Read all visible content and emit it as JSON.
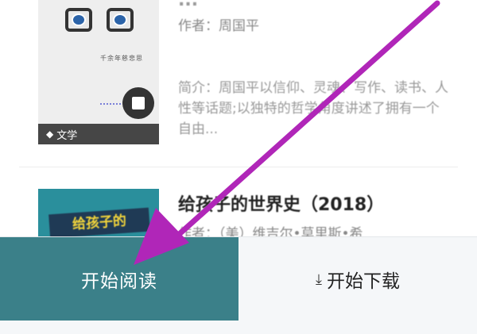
{
  "books": [
    {
      "title": "...",
      "author_label": "作者：",
      "author": "周国平",
      "intro_label": "简介：",
      "intro": "周国平以信仰、灵魂、写作、读书、人性等话题;以独特的哲学角度讲述了拥有一个自由...",
      "category": "文学",
      "cover_text": "千余年慈悲思"
    },
    {
      "title": "给孩子的世界史（2018）",
      "author_label": "作者：",
      "author": "（美）维吉尔•莫里斯•希",
      "cover_text": "给孩子的"
    }
  ],
  "actions": {
    "read_label": "开始阅读",
    "download_label": "开始下载",
    "download_icon": "download-arrow-icon"
  },
  "colors": {
    "primary": "#3b8089",
    "secondary_bg": "#f5f7f9",
    "annotation_arrow": "#b026b8"
  }
}
